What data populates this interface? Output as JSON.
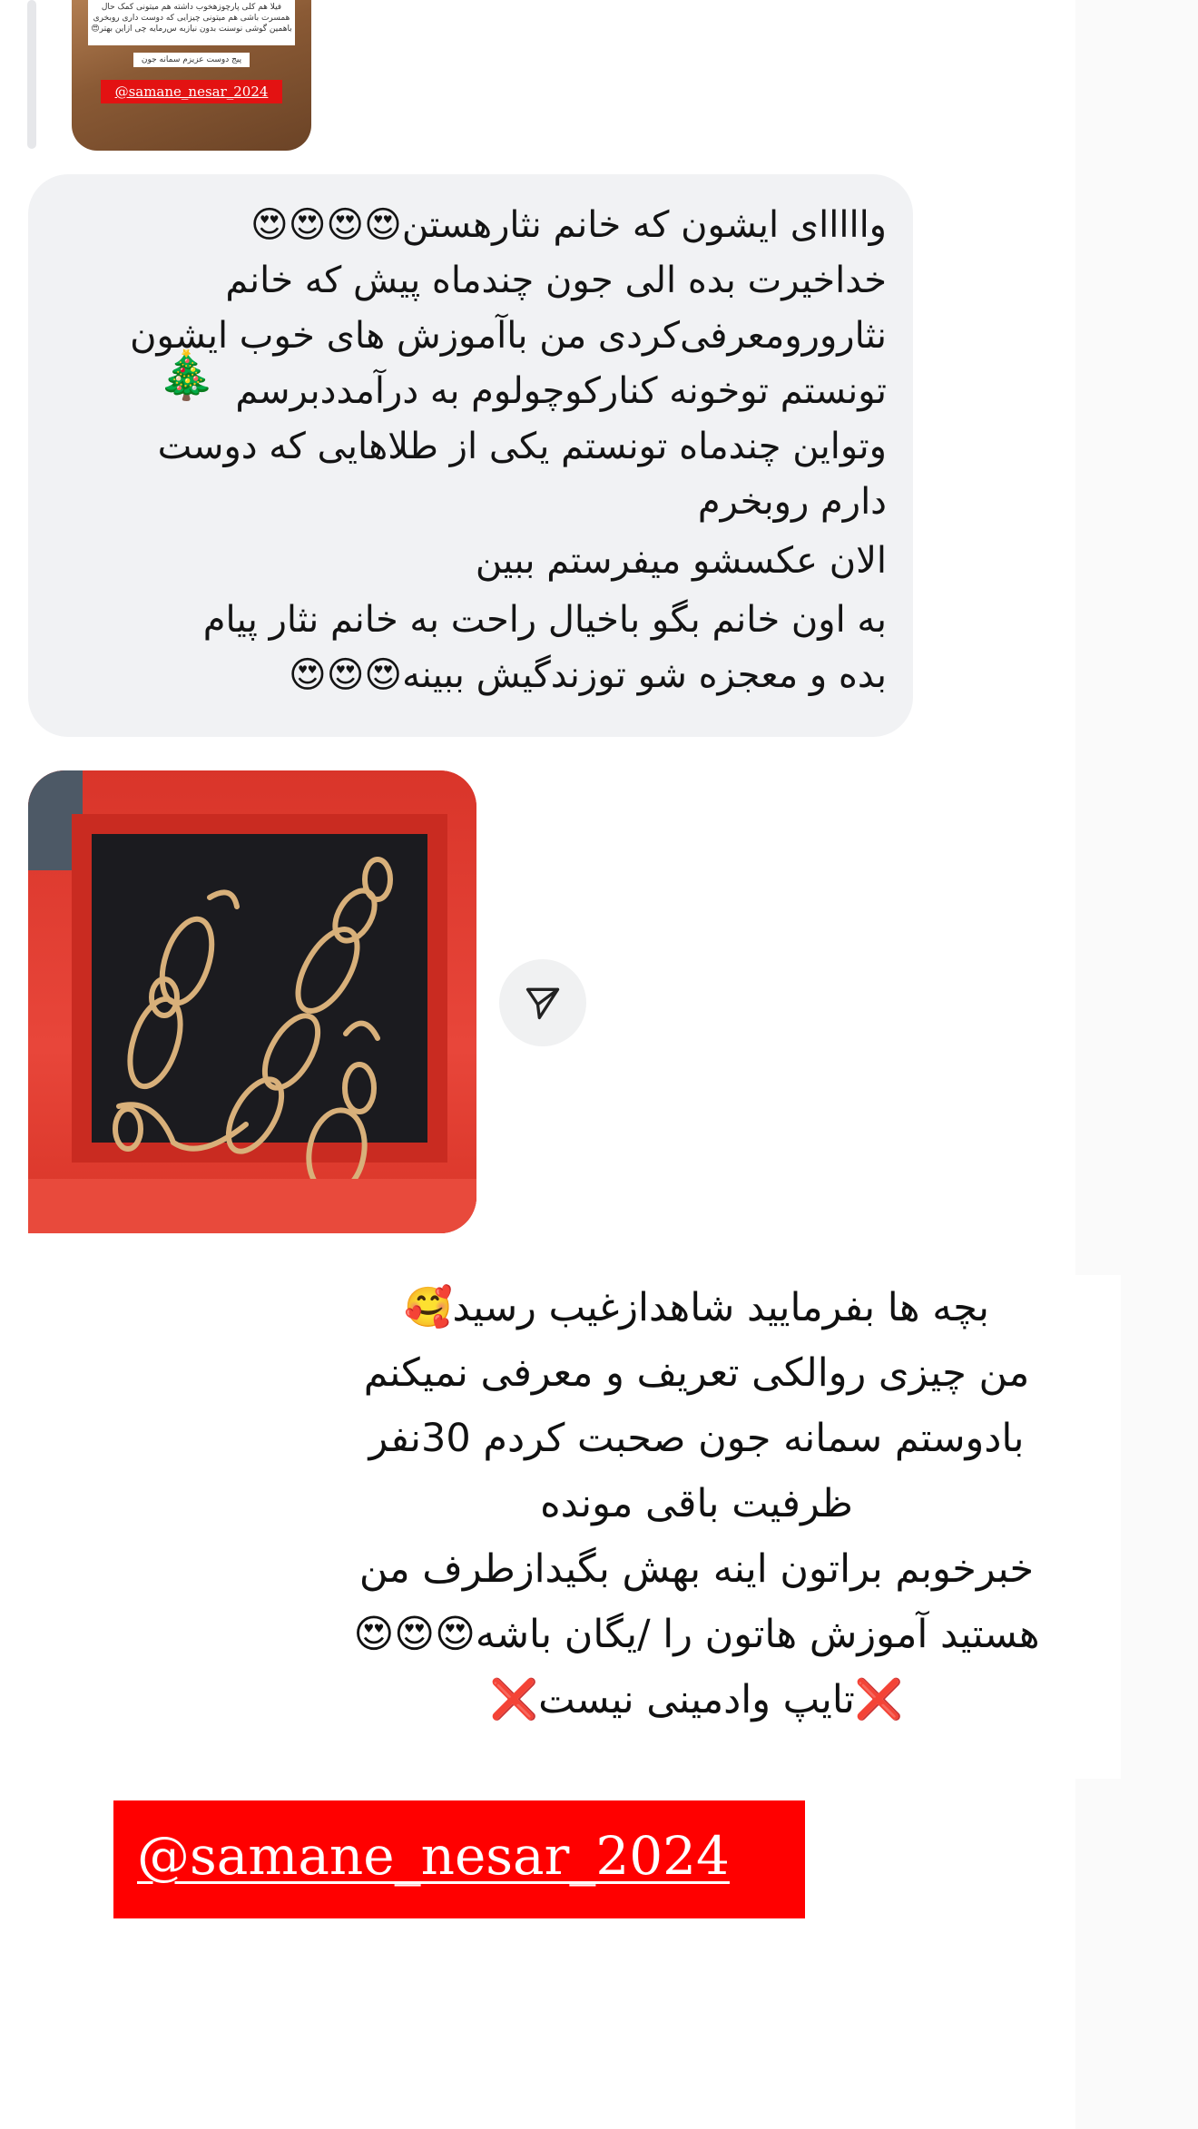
{
  "story_reply": {
    "note_text": "فیلا هم کلی پارچوزهخوب داشته هم میتونی کمک حال همسرت باشی هم میتونی چیزایی که دوست داری روبخری باهمین گوشی نوسنت بدون نیازبه س‌رمایه چی ازاین بهتر😍",
    "caption": "پیج دوست عزیزم سمانه جون",
    "handle": "@samane_nesar_2024"
  },
  "message": {
    "lines": [
      "وااااای ایشون که خانم نثارهستن😍😍😍😍",
      "خداخیرت بده الی جون چندماه پیش که خانم",
      "نثارورومعرفی‌کردی من باآموزش های خوب ایشون",
      "تونستم توخونه کنارکوچولوم به درآمددبرسم",
      "وتواین چندماه تونستم یکی از طلاهایی که دوست",
      "دارم روبخرم",
      "الان عکسشو میفرستم ببین",
      "به اون خانم بگو باخیال راحت به خانم نثار پیام",
      "بده و معجزه شو توزندگیش ببینه😍😍😍"
    ],
    "tree_emoji": "🎄"
  },
  "photo": {
    "icon": "paper-plane-icon"
  },
  "announcement": {
    "lines": [
      "بچه ها بفرمایید شاهدازغیب رسید🥰",
      "من چیزی روالکی تعریف و معرفی نمیکنم",
      "بادوستم سمانه جون صحبت کردم 30نفر",
      "ظرفیت باقی مونده",
      "خبرخوبم براتون اینه بهش بگیدازطرف من",
      "هستید آموزش هاتون را /یگان باشه😍😍😍"
    ],
    "last_line_text": "تایپ وادمینی نیست",
    "cross_mark": "❌"
  },
  "banner": {
    "handle": "@samane_nesar_2024",
    "background": "#ff0000"
  }
}
